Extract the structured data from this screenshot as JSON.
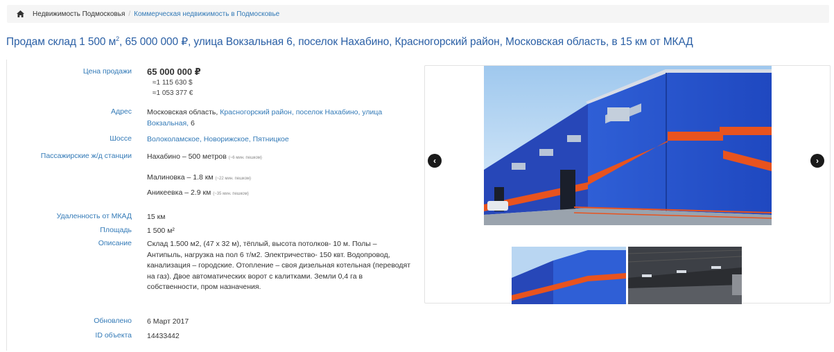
{
  "breadcrumb": {
    "home_icon": "home-icon",
    "items": [
      "Недвижимость Подмосковья",
      "Коммерческая недвижимость в Подмосковье"
    ],
    "separator": "/"
  },
  "title": {
    "part1": "Продам склад 1 500 м",
    "sup": "2",
    "part2": ", 65 000 000 ₽, улица Вокзальная 6, поселок Нахабино, Красногорский район, Московская область, в 15 км от МКАД"
  },
  "details": {
    "price_label": "Цена продажи",
    "price": "65 000 000  ₽",
    "price_usd": "≈1 115 630 $",
    "price_eur": "≈1 053 377 €",
    "address_label": "Адрес",
    "address_region": "Московская область,",
    "address_district": "Красногорский район,",
    "address_settlement": "поселок Нахабино,",
    "address_street": "улица Вокзальная,",
    "address_house": "6",
    "highway_label": "Шоссе",
    "highway_1": "Волоколамское,",
    "highway_2": "Новорижское,",
    "highway_3": "Пятницкое",
    "stations_label": "Пассажирские ж/д станции",
    "stations": [
      {
        "name": "Нахабино",
        "distance": " – 500 метров",
        "note": "(~6 мин. пешком)"
      },
      {
        "name": "Малиновка",
        "distance": " – 1.8 км",
        "note": "(~22 мин. пешком)"
      },
      {
        "name": "Аникеевка",
        "distance": " – 2.9 км",
        "note": "(~35 мин. пешком)"
      }
    ],
    "mkad_label": "Удаленность от МКАД",
    "mkad": "15 км",
    "area_label": "Площадь",
    "area": "1 500 м²",
    "description_label": "Описание",
    "description": "Склад 1.500 м2, (47 х 32 м), тёплый, высота потолков- 10 м. Полы – Антипыль, нагрузка на пол 6 т/м2. Электричество- 150 квт. Водопровод, канализация – городские. Отопление – своя дизельная котельная (переводят на газ). Двое автоматических ворот с калитками. Земли 0,4 га в собственности, пром назначения.",
    "updated_label": "Обновлено",
    "updated": "6 Март 2017",
    "id_label": "ID объекта",
    "id": "14433442"
  },
  "gallery": {
    "prev_icon": "chevron-left-icon",
    "next_icon": "chevron-right-icon",
    "building_color": "#2a55c9",
    "stripe_color": "#e8531e"
  }
}
